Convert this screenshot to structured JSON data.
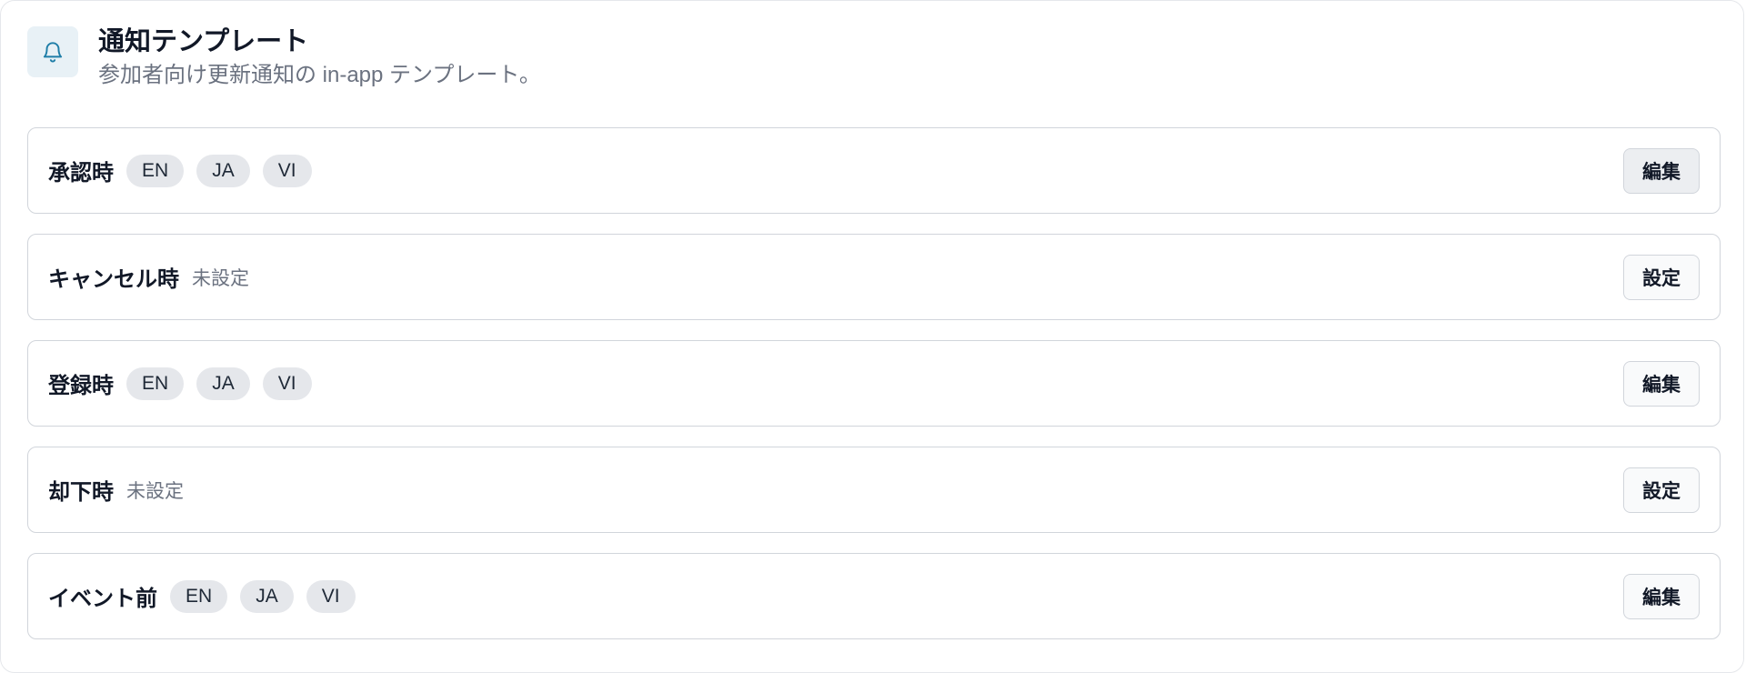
{
  "header": {
    "icon": "bell-icon",
    "title": "通知テンプレート",
    "subtitle": "参加者向け更新通知の in-app テンプレート。"
  },
  "colors": {
    "accent": "#1f7ea8",
    "icon_bg": "#e8f1f6"
  },
  "templates": [
    {
      "label": "承認時",
      "languages": [
        "EN",
        "JA",
        "VI"
      ],
      "status": "",
      "action": "編集"
    },
    {
      "label": "キャンセル時",
      "languages": [],
      "status": "未設定",
      "action": "設定"
    },
    {
      "label": "登録時",
      "languages": [
        "EN",
        "JA",
        "VI"
      ],
      "status": "",
      "action": "編集"
    },
    {
      "label": "却下時",
      "languages": [],
      "status": "未設定",
      "action": "設定"
    },
    {
      "label": "イベント前",
      "languages": [
        "EN",
        "JA",
        "VI"
      ],
      "status": "",
      "action": "編集"
    }
  ]
}
